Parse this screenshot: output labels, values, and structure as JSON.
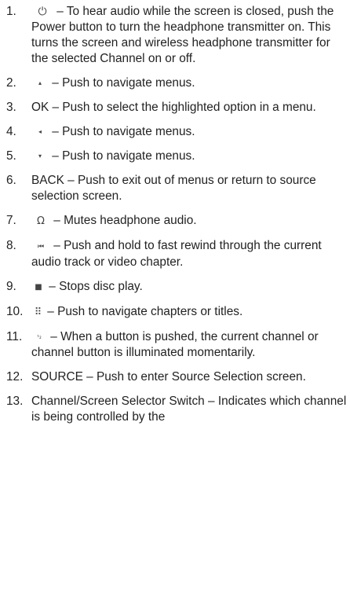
{
  "items": [
    {
      "num": "1.",
      "symbol": "⏻",
      "text": " – To hear audio while the screen is closed, push the Power button to turn the headphone transmitter on. This turns the screen and wireless headphone transmitter for the selected Channel on or off."
    },
    {
      "num": "2.",
      "symbol": "▴",
      "text": " – Push to navigate menus."
    },
    {
      "num": "3.",
      "text": "OK – Push to select the highlighted option in a menu."
    },
    {
      "num": "4.",
      "symbol": "◂",
      "text": " – Push to navigate menus."
    },
    {
      "num": "5.",
      "symbol": "▾",
      "text": " – Push to navigate menus."
    },
    {
      "num": "6.",
      "text": "BACK – Push to exit out of menus or return to source selection screen."
    },
    {
      "num": "7.",
      "symbol": "Ω",
      "text": " – Mutes headphone audio."
    },
    {
      "num": "8.",
      "symbol": "⏮",
      "text": " – Push and hold to fast rewind through the current audio track or video chapter."
    },
    {
      "num": "9.",
      "symbol": "■",
      "text": " – Stops disc play."
    },
    {
      "num": "10.",
      "symbol": "⠿",
      "text": " – Push to navigate chapters or titles."
    },
    {
      "num": "11.",
      "symbol": "¹₂",
      "text": " – When a button is pushed, the current channel or channel button is illuminated momentarily."
    },
    {
      "num": "12.",
      "text": "SOURCE – Push to enter Source Selection screen."
    },
    {
      "num": "13.",
      "text": "Channel/Screen Selector Switch – Indicates which channel is being controlled by the"
    }
  ]
}
